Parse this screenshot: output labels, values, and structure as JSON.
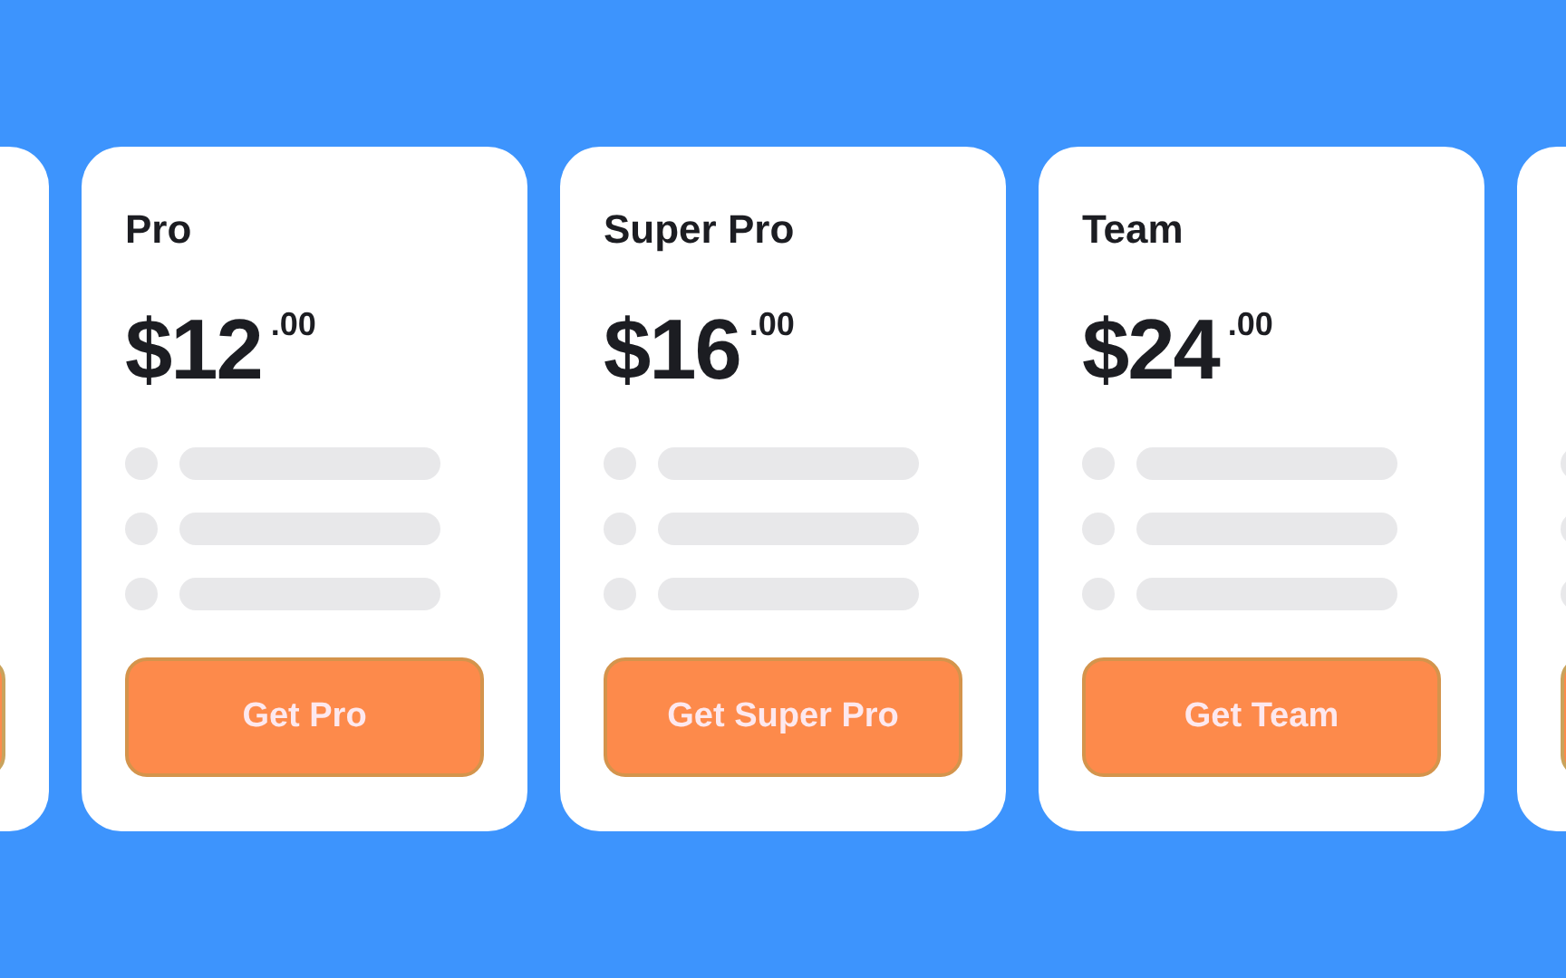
{
  "plans": [
    {
      "kind": "partial"
    },
    {
      "kind": "full",
      "title": "Pro",
      "price": "$12",
      "cents": ".00",
      "button": "Get Pro"
    },
    {
      "kind": "full",
      "title": "Super Pro",
      "price": "$16",
      "cents": ".00",
      "button": "Get Super Pro"
    },
    {
      "kind": "full",
      "title": "Team",
      "price": "$24",
      "cents": ".00",
      "button": "Get Team"
    },
    {
      "kind": "partial"
    }
  ]
}
